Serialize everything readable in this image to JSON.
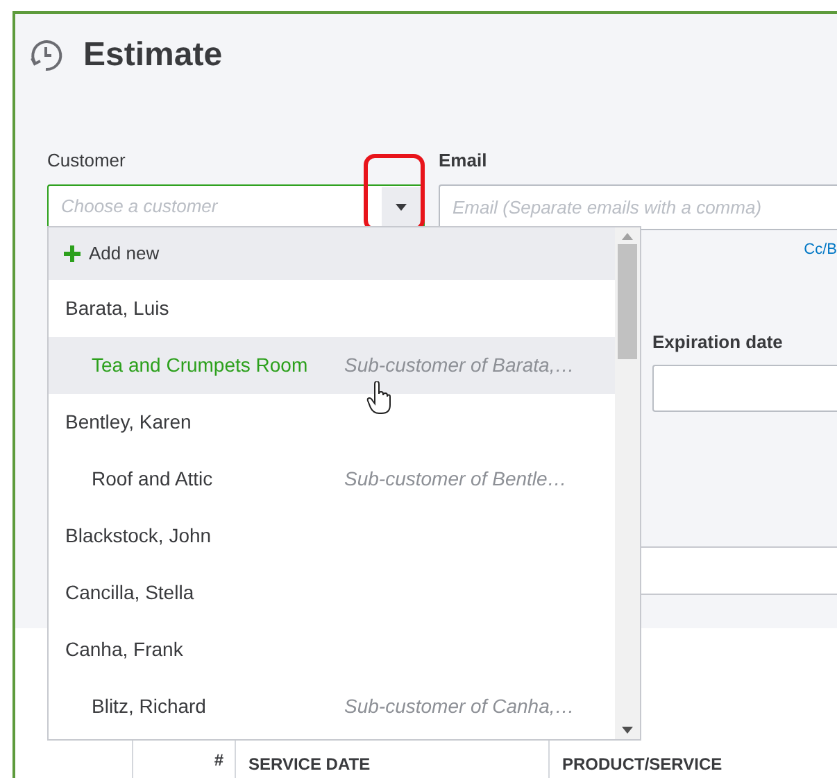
{
  "page": {
    "title": "Estimate"
  },
  "customer": {
    "label": "Customer",
    "placeholder": "Choose a customer"
  },
  "email": {
    "label": "Email",
    "placeholder": "Email (Separate emails with a comma)"
  },
  "cc_link": "Cc/B",
  "expiration_date": {
    "label": "Expiration date"
  },
  "dropdown": {
    "add_new": "Add new",
    "items": [
      {
        "name": "Barata, Luis",
        "selected": false,
        "children": [
          {
            "name": "Tea and Crumpets Room",
            "note": "Sub-customer of Barata,…",
            "selected": true
          }
        ]
      },
      {
        "name": "Bentley, Karen",
        "selected": false,
        "children": [
          {
            "name": "Roof and Attic",
            "note": "Sub-customer of Bentle…",
            "selected": false
          }
        ]
      },
      {
        "name": "Blackstock, John",
        "selected": false
      },
      {
        "name": "Cancilla, Stella",
        "selected": false
      },
      {
        "name": "Canha, Frank",
        "selected": false,
        "children": [
          {
            "name": "Blitz, Richard",
            "note": "Sub-customer of Canha,…",
            "selected": false
          }
        ]
      }
    ]
  },
  "table": {
    "columns": [
      "#",
      "SERVICE DATE",
      "PRODUCT/SERVICE"
    ]
  }
}
